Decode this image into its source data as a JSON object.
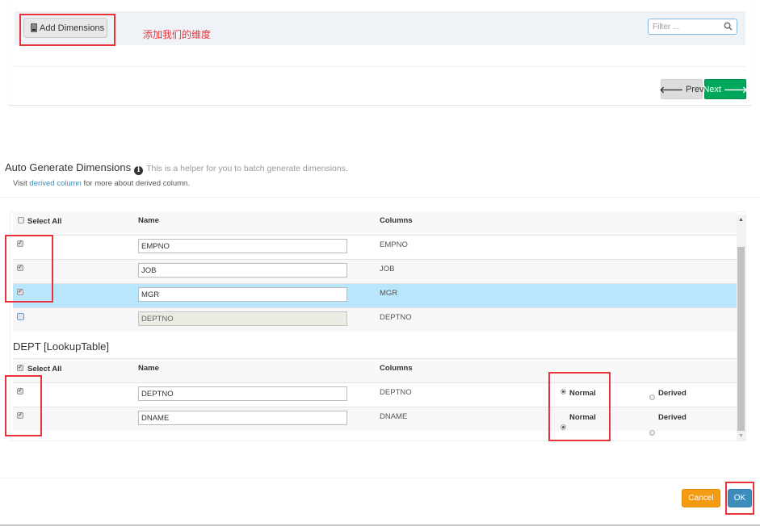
{
  "toolbar": {
    "add_dimensions_label": "Add Dimensions",
    "annotation_text": "添加我们的维度",
    "filter_placeholder": "Filter ...",
    "prev_label": "Prev",
    "next_label": "Next"
  },
  "modal": {
    "title": "Auto Generate Dimensions",
    "helper_text": "This is a helper for you to batch generate dimensions.",
    "visit_prefix": "Visit",
    "visit_link": "derived column",
    "visit_suffix": "for more about derived column.",
    "fact_table": {
      "headers": {
        "select_all": "Select All",
        "name": "Name",
        "columns": "Columns"
      },
      "select_all_checked": false,
      "rows": [
        {
          "checked": true,
          "name": "EMPNO",
          "column": "EMPNO",
          "disabled": false,
          "highlighted": false
        },
        {
          "checked": true,
          "name": "JOB",
          "column": "JOB",
          "disabled": false,
          "highlighted": false
        },
        {
          "checked": true,
          "name": "MGR",
          "column": "MGR",
          "disabled": false,
          "highlighted": true
        },
        {
          "checked": false,
          "name": "DEPTNO",
          "column": "DEPTNO",
          "disabled": true,
          "highlighted": false
        }
      ]
    },
    "lookup_table": {
      "title": "DEPT [LookupTable]",
      "headers": {
        "select_all": "Select All",
        "name": "Name",
        "columns": "Columns"
      },
      "select_all_checked": true,
      "rows": [
        {
          "checked": true,
          "name": "DEPTNO",
          "column": "DEPTNO",
          "type": "Normal"
        },
        {
          "checked": true,
          "name": "DNAME",
          "column": "DNAME",
          "type": "Normal"
        }
      ],
      "type_options": [
        "Normal",
        "Derived"
      ]
    },
    "cancel_label": "Cancel",
    "ok_label": "OK"
  },
  "colors": {
    "annotation_red": "#e8333a",
    "next_green": "#00a65a",
    "cancel_orange": "#f39c12",
    "ok_blue": "#3c8dbc",
    "row_highlight": "#bae6fc",
    "link_blue": "#3c8dbc"
  }
}
